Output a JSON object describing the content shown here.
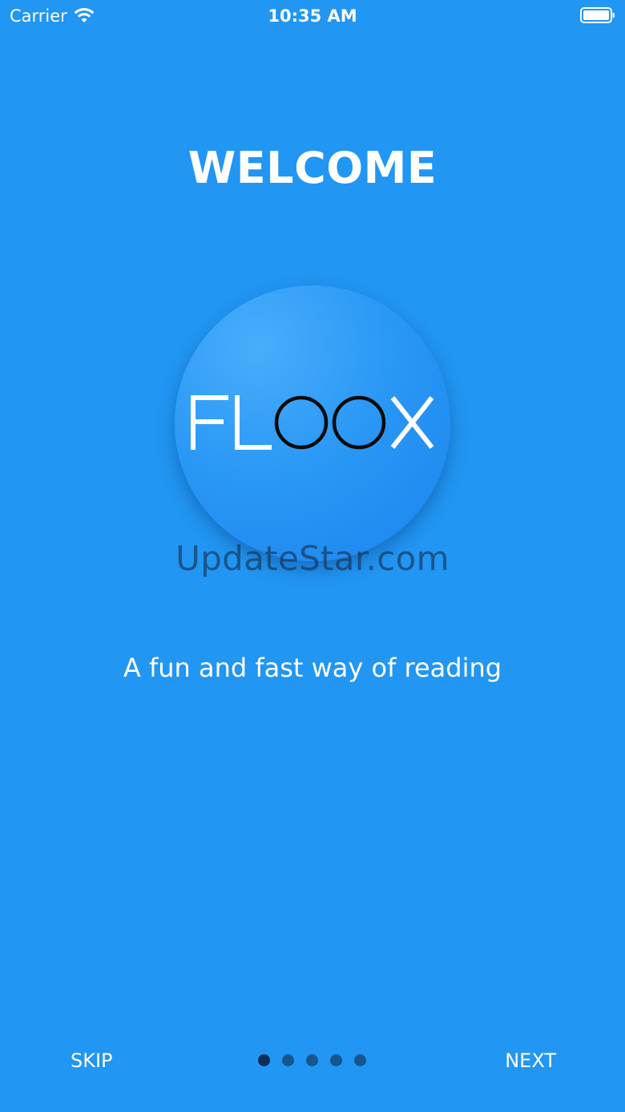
{
  "status_bar": {
    "carrier": "Carrier",
    "time": "10:35 AM",
    "wifi_icon": "wifi-icon",
    "battery_icon": "battery-icon"
  },
  "welcome": {
    "title": "WELCOME",
    "logo_text": "FLOOX",
    "watermark": "UpdateStar.com",
    "tagline": "A fun and fast way of reading"
  },
  "navigation": {
    "skip_label": "SKIP",
    "next_label": "NEXT",
    "page_count": 5,
    "current_page": 1
  },
  "colors": {
    "background": "#2196F3",
    "text": "#FFFFFF",
    "dot_active": "#0D2F55",
    "dot_inactive": "#17558F"
  }
}
